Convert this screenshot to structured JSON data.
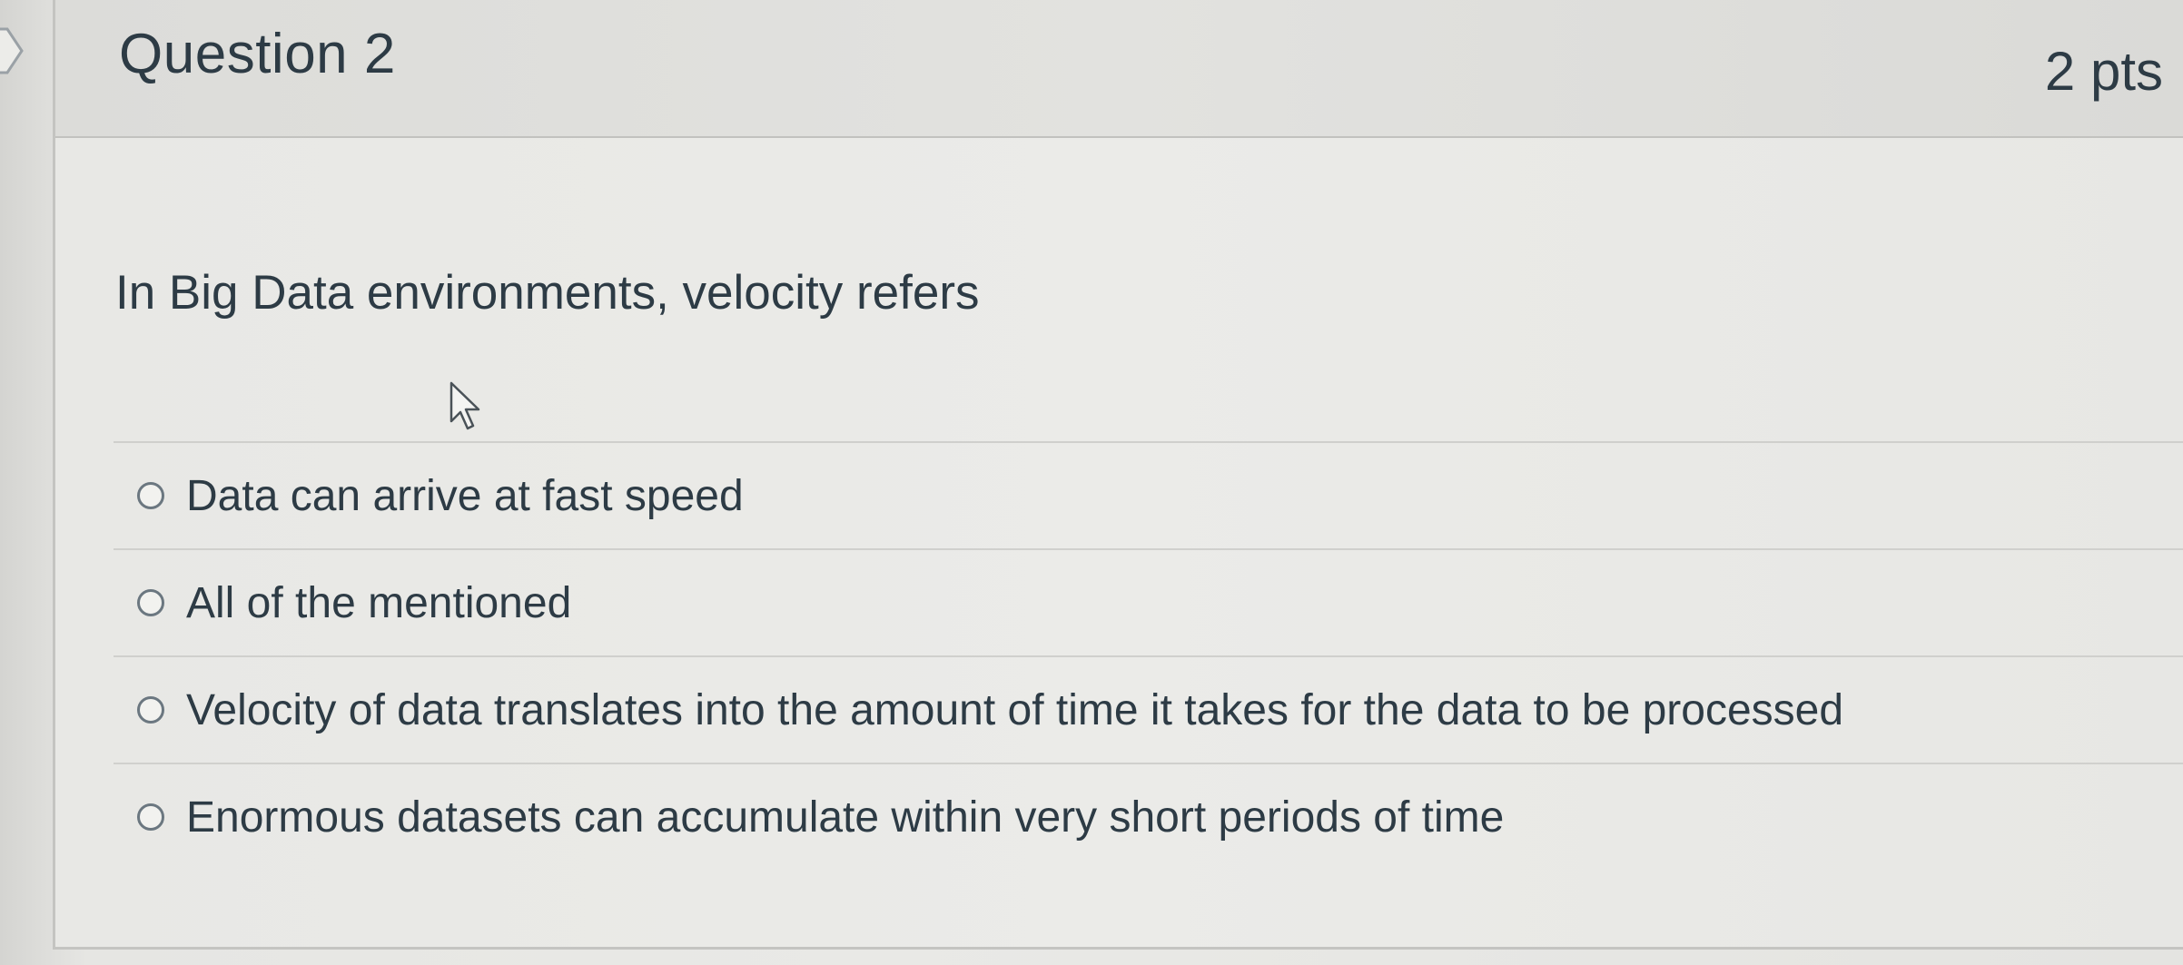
{
  "question": {
    "title": "Question 2",
    "points": "2 pts",
    "text": "In Big Data environments, velocity refers"
  },
  "answers": [
    {
      "label": "Data can arrive at fast speed",
      "selected": false
    },
    {
      "label": "All of the mentioned",
      "selected": false
    },
    {
      "label": "Velocity of data translates into the amount of time it takes for the data to be processed",
      "selected": false
    },
    {
      "label": "Enormous datasets can accumulate within very short periods of time",
      "selected": false
    }
  ],
  "icons": {
    "flag": "question-flag-icon",
    "cursor": "mouse-pointer-icon",
    "radio": "radio-button-icon"
  },
  "colors": {
    "text": "#2d3b45",
    "header_bg": "#dcdcd9",
    "card_bg": "#e9e9e6",
    "divider": "#d0d0cd"
  }
}
